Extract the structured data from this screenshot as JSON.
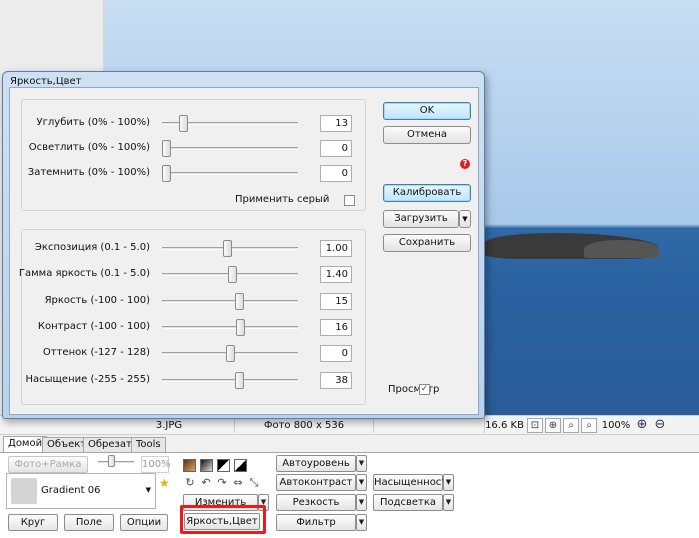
{
  "statusbar": {
    "filename": "3.JPG",
    "dimensions": "Фото 800 x 536",
    "filesize": "16.6 KB",
    "zoom": "100%"
  },
  "tabs": [
    {
      "label": "Домой"
    },
    {
      "label": "Объект"
    },
    {
      "label": "Обрезать"
    },
    {
      "label": "Tools"
    }
  ],
  "ribbon": {
    "photo_frame_button": "Фото+Рамка",
    "opacity_value": "100%",
    "gradient_name": "Gradient 06",
    "circle_button": "Круг",
    "field_button": "Поле",
    "options_button": "Опции",
    "change_button": "Изменить",
    "brightness_color_button": "Яркость,Цвет",
    "auto_level_button": "Автоуровень",
    "auto_contrast_button": "Автоконтраст",
    "sharpness_button": "Резкость",
    "filter_button": "Фильтр",
    "saturation_button": "Насыщенность",
    "highlight_button": "Подсветка"
  },
  "dialog": {
    "title": "Яркость,Цвет",
    "group1": [
      {
        "label": "Углубить (0% - 100%)",
        "value": "13",
        "position": 0.13
      },
      {
        "label": "Осветлить (0% - 100%)",
        "value": "0",
        "position": 0.0
      },
      {
        "label": "Затемнить (0% - 100%)",
        "value": "0",
        "position": 0.0
      }
    ],
    "apply_gray_label": "Применить серый",
    "apply_gray_checked": false,
    "group2": [
      {
        "label": "Экспозиция (0.1 - 5.0)",
        "value": "1.00",
        "position": 0.48
      },
      {
        "label": "Гамма яркость (0.1 - 5.0)",
        "value": "1.40",
        "position": 0.52
      },
      {
        "label": "Яркость (-100 - 100)",
        "value": "15",
        "position": 0.575
      },
      {
        "label": "Контраст (-100 - 100)",
        "value": "16",
        "position": 0.58
      },
      {
        "label": "Оттенок (-127 - 128)",
        "value": "0",
        "position": 0.5
      },
      {
        "label": "Насыщение (-255 - 255)",
        "value": "38",
        "position": 0.575
      }
    ],
    "preview_label": "Просмотр",
    "preview_checked": true,
    "ok_button": "OK",
    "cancel_button": "Отмена",
    "calibrate_button": "Калибровать",
    "load_button": "Загрузить",
    "save_button": "Сохранить"
  }
}
